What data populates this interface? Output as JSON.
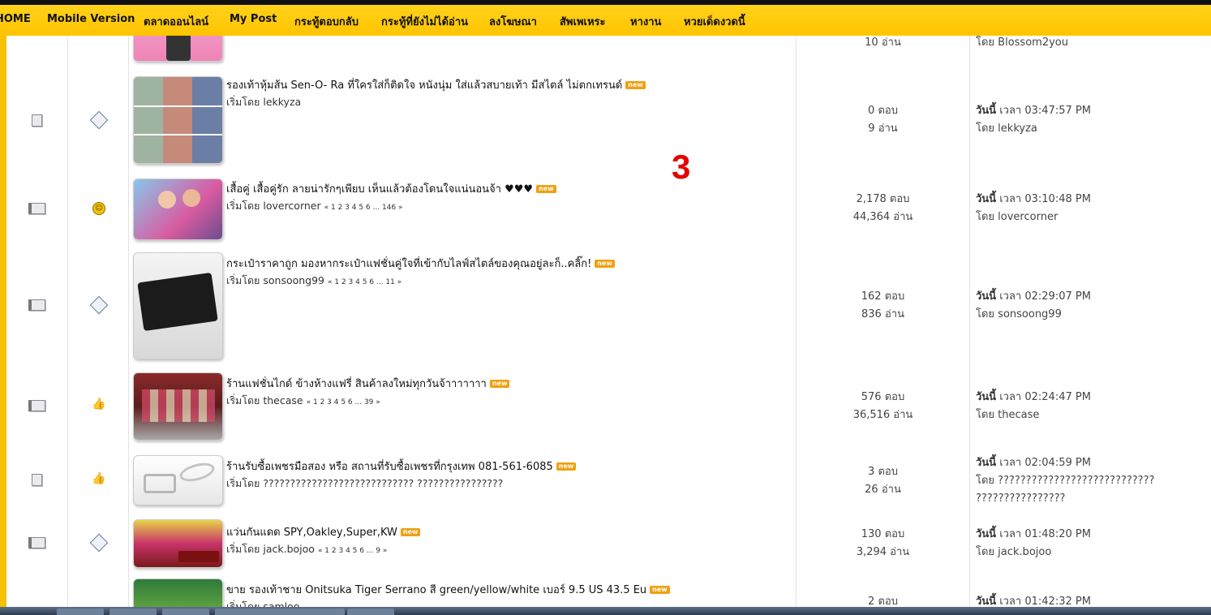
{
  "nav": {
    "items": [
      "HOME",
      "Mobile Version",
      "ตลาดออนไลน์",
      "My Post",
      "กระทู้ตอบกลับ",
      "กระทู้ที่ยังไม่ได้อ่าน",
      "ลงโฆษณา",
      "สัพเพเหระ",
      "หางาน",
      "หวยเด็ดงวดนี้"
    ]
  },
  "overlay_number": "3",
  "partial_top": {
    "reads": "10 อ่าน",
    "last_by": "โดย Blossom2you"
  },
  "rows": [
    {
      "title": "รองเท้าหุ้มส้น Sen-O- Ra ที่ใครใส่ก็ติดใจ หนังนุ่ม ใส่แล้วสบายเท้า มีสไตล์ ไม่ตกเทรนด์",
      "badge": "new",
      "starter": "เริ่มโดย lekkyza",
      "pages": "",
      "replies": "0 ตอบ",
      "reads": "9 อ่าน",
      "last_when_prefix": "วันนี้",
      "last_time": " เวลา 03:47:57 PM",
      "last_by": "โดย lekkyza"
    },
    {
      "title": "เสื้อคู่ เสื้อคู่รัก ลายน่ารักๆเพียบ เห็นแล้วต้องโดนใจแน่นอนจ้า ♥♥♥",
      "badge": "new",
      "starter": "เริ่มโดย lovercorner",
      "pages": "« 1 2 3 4 5 6 ... 146 »",
      "replies": "2,178 ตอบ",
      "reads": "44,364 อ่าน",
      "last_when_prefix": "วันนี้",
      "last_time": " เวลา 03:10:48 PM",
      "last_by": "โดย lovercorner"
    },
    {
      "title": "กระเป๋าราคาถูก มองหากระเป๋าแฟชั่นคู่ใจที่เข้ากับไลฟ์สไตล์ของคุณอยู่ละก็..คลิ๊ก!",
      "badge": "new",
      "starter": "เริ่มโดย sonsoong99",
      "pages": "« 1 2 3 4 5 6 ... 11 »",
      "replies": "162 ตอบ",
      "reads": "836 อ่าน",
      "last_when_prefix": "วันนี้",
      "last_time": " เวลา 02:29:07 PM",
      "last_by": "โดย sonsoong99"
    },
    {
      "title": "ร้านแฟชั่นไกด์ ข้างห้างแฟรี่ สินค้าลงใหม่ทุกวันจ้าาาาาาา",
      "badge": "new",
      "starter": "เริ่มโดย thecase",
      "pages": "« 1 2 3 4 5 6 ... 39 »",
      "replies": "576 ตอบ",
      "reads": "36,516 อ่าน",
      "last_when_prefix": "วันนี้",
      "last_time": " เวลา 02:24:47 PM",
      "last_by": "โดย thecase"
    },
    {
      "title": "ร้านรับซื้อเพชรมือสอง หรือ สถานที่รับซื้อเพชรที่กรุงเทพ 081-561-6085",
      "badge": "new",
      "starter": "เริ่มโดย ???????????????????????????? ????????????????",
      "pages": "",
      "replies": "3 ตอบ",
      "reads": "26 อ่าน",
      "last_when_prefix": "วันนี้",
      "last_time": " เวลา 02:04:59 PM",
      "last_by": "โดย ???????????????????????????? ????????????????"
    },
    {
      "title": "แว่นกันแดด SPY,Oakley,Super,KW",
      "badge": "new",
      "starter": "เริ่มโดย jack.bojoo",
      "pages": "« 1 2 3 4 5 6 ... 9 »",
      "replies": "130 ตอบ",
      "reads": "3,294 อ่าน",
      "last_when_prefix": "วันนี้",
      "last_time": " เวลา 01:48:20 PM",
      "last_by": "โดย jack.bojoo"
    },
    {
      "title": "ขาย รองเท้าชาย Onitsuka Tiger Serrano สี green/yellow/white เบอร์ 9.5 US 43.5 Eu",
      "badge": "new",
      "starter": "เริ่มโดย samloo",
      "pages": "",
      "replies": "2 ตอบ",
      "reads": "",
      "last_when_prefix": "วันนี้",
      "last_time": " เวลา 01:42:32 PM",
      "last_by": ""
    }
  ]
}
